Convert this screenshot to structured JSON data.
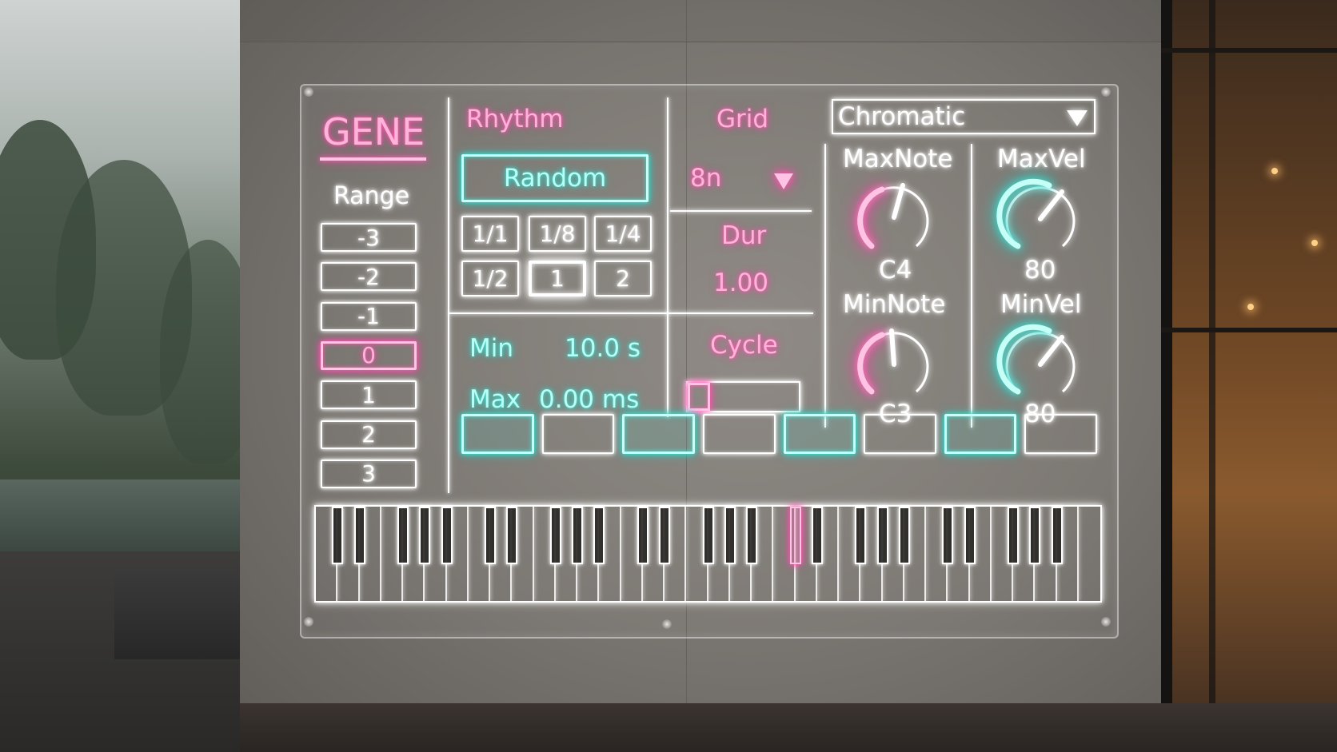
{
  "app": {
    "title": "GENE"
  },
  "range": {
    "label": "Range",
    "options": [
      "-3",
      "-2",
      "-1",
      "0",
      "1",
      "2",
      "3"
    ],
    "selected": "0"
  },
  "rhythm": {
    "label": "Rhythm",
    "random_label": "Random",
    "divisions": [
      "1/1",
      "1/8",
      "1/4",
      "1/2",
      "1",
      "2"
    ],
    "selected": "1",
    "min_label": "Min",
    "min_value": "10.0 s",
    "max_label": "Max",
    "max_value": "0.00 ms"
  },
  "grid": {
    "label": "Grid",
    "value": "8n",
    "dropdown_icon": "triangle-down-icon"
  },
  "dur": {
    "label": "Dur",
    "value": "1.00"
  },
  "cycle": {
    "label": "Cycle",
    "fill": 0.2
  },
  "scale": {
    "value": "Chromatic",
    "dropdown_icon": "triangle-down-icon"
  },
  "knobs": {
    "max_note": {
      "label": "MaxNote",
      "value": "C4",
      "color": "#ff5eb5"
    },
    "max_vel": {
      "label": "MaxVel",
      "value": "80",
      "color": "#3ee6d8"
    },
    "min_note": {
      "label": "MinNote",
      "value": "C3",
      "color": "#ff5eb5"
    },
    "min_vel": {
      "label": "MinVel",
      "value": "80",
      "color": "#3ee6d8"
    }
  },
  "steps": [
    true,
    false,
    true,
    false,
    true,
    false,
    true,
    false
  ],
  "keyboard": {
    "white_keys": 36,
    "active_black_key": 15
  },
  "colors": {
    "pink": "#ff5eb5",
    "cyan": "#3ee6d8",
    "white": "#ffffff"
  }
}
